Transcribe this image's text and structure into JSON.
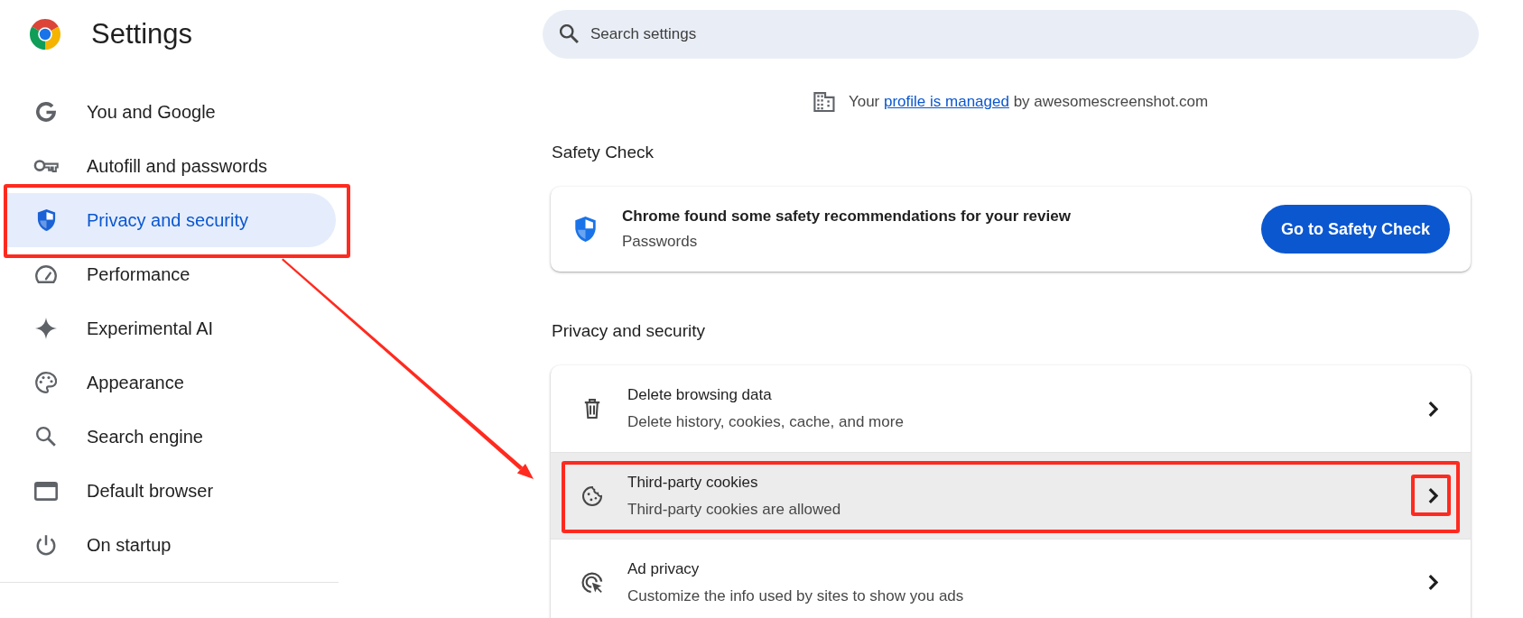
{
  "sidebar": {
    "title": "Settings",
    "items": [
      {
        "label": "You and Google",
        "selected": false,
        "marked": false
      },
      {
        "label": "Autofill and passwords",
        "selected": false,
        "marked": false
      },
      {
        "label": "Privacy and security",
        "selected": true,
        "marked": true
      },
      {
        "label": "Performance",
        "selected": false,
        "marked": false
      },
      {
        "label": "Experimental AI",
        "selected": false,
        "marked": false
      },
      {
        "label": "Appearance",
        "selected": false,
        "marked": false
      },
      {
        "label": "Search engine",
        "selected": false,
        "marked": false
      },
      {
        "label": "Default browser",
        "selected": false,
        "marked": false
      },
      {
        "label": "On startup",
        "selected": false,
        "marked": false
      }
    ]
  },
  "search": {
    "placeholder": "Search settings"
  },
  "managed_notice": {
    "before": "Your",
    "link": "profile is managed",
    "after": "by awesomescreenshot.com"
  },
  "safety_check": {
    "heading": "Safety Check",
    "title": "Chrome found some safety recommendations for your review",
    "subtitle": "Passwords",
    "button": "Go to Safety Check"
  },
  "privacy_section": {
    "heading": "Privacy and security",
    "rows": [
      {
        "title": "Delete browsing data",
        "subtitle": "Delete history, cookies, cache, and more",
        "hovered": false,
        "marked": false,
        "chevron_marked": false
      },
      {
        "title": "Third-party cookies",
        "subtitle": "Third-party cookies are allowed",
        "hovered": true,
        "marked": true,
        "chevron_marked": true
      },
      {
        "title": "Ad privacy",
        "subtitle": "Customize the info used by sites to show you ads",
        "hovered": false,
        "marked": false,
        "chevron_marked": false
      }
    ]
  },
  "annotation_arrow": true
}
